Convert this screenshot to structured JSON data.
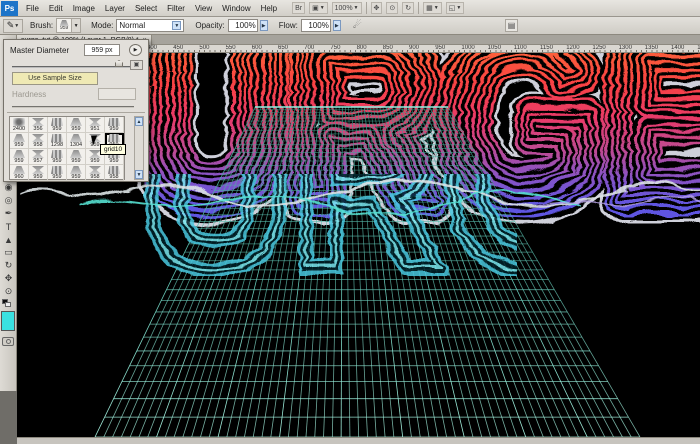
{
  "menubar": {
    "logo": "Ps",
    "menus": [
      "File",
      "Edit",
      "Image",
      "Layer",
      "Select",
      "Filter",
      "View",
      "Window",
      "Help"
    ],
    "appbar_zoom": "100%",
    "bridge_label": "Br"
  },
  "optionsbar": {
    "brush_label": "Brush:",
    "brush_preview_size": "959",
    "mode_label": "Mode:",
    "mode_value": "Normal",
    "opacity_label": "Opacity:",
    "opacity_value": "100%",
    "flow_label": "Flow:",
    "flow_value": "100%"
  },
  "document": {
    "tab_title": "surge_tut @ 100% (Layer 1, RGB/8) *",
    "tab_close": "×",
    "ruler": {
      "start": 400,
      "end": 1450,
      "step": 50
    },
    "artwork_text": "URGE"
  },
  "brush_panel": {
    "master_diameter_label": "Master Diameter",
    "master_diameter_value": "959 px",
    "use_sample_size_label": "Use Sample Size",
    "hardness_label": "Hardness",
    "tooltip": "grid10",
    "selected_row": 1,
    "selected_col": 5,
    "presets": [
      [
        "2400",
        "356",
        "959",
        "959",
        "951",
        "959"
      ],
      [
        "959",
        "958",
        "1298",
        "1304",
        "959",
        "959"
      ],
      [
        "959",
        "957",
        "959",
        "959",
        "959",
        "959"
      ],
      [
        "960",
        "959",
        "959",
        "959",
        "958",
        "958"
      ]
    ]
  },
  "toolbar": {
    "tools": [
      {
        "name": "eraser-tool",
        "glyph": "◰"
      },
      {
        "name": "gradient-tool",
        "glyph": "▧"
      },
      {
        "name": "blur-tool",
        "glyph": "◉"
      },
      {
        "name": "dodge-tool",
        "glyph": "◎"
      },
      {
        "name": "pen-tool",
        "glyph": "✒"
      },
      {
        "name": "type-tool",
        "glyph": "T"
      },
      {
        "name": "path-select-tool",
        "glyph": "▲"
      },
      {
        "name": "shape-tool",
        "glyph": "▭"
      },
      {
        "name": "3d-rotate-tool",
        "glyph": "↻"
      },
      {
        "name": "hand-tool",
        "glyph": "✥"
      },
      {
        "name": "zoom-tool",
        "glyph": "⊙"
      }
    ],
    "foreground_color": "#3ae1e1"
  },
  "colors": {
    "canvas_bg": "#000000",
    "grid_teal_dim": "#3a9a8c",
    "grid_teal_bright": "#aefce9",
    "letter_top": "#ff7434",
    "letter_red": "#f94343",
    "letter_pink": "#ea3a68",
    "letter_magenta": "#c2498f",
    "letter_purple": "#8e52c0",
    "letter_blue": "#5f55e0",
    "outline_silver": "#cfd0da",
    "reflection_cyan": "#49c8e0"
  }
}
